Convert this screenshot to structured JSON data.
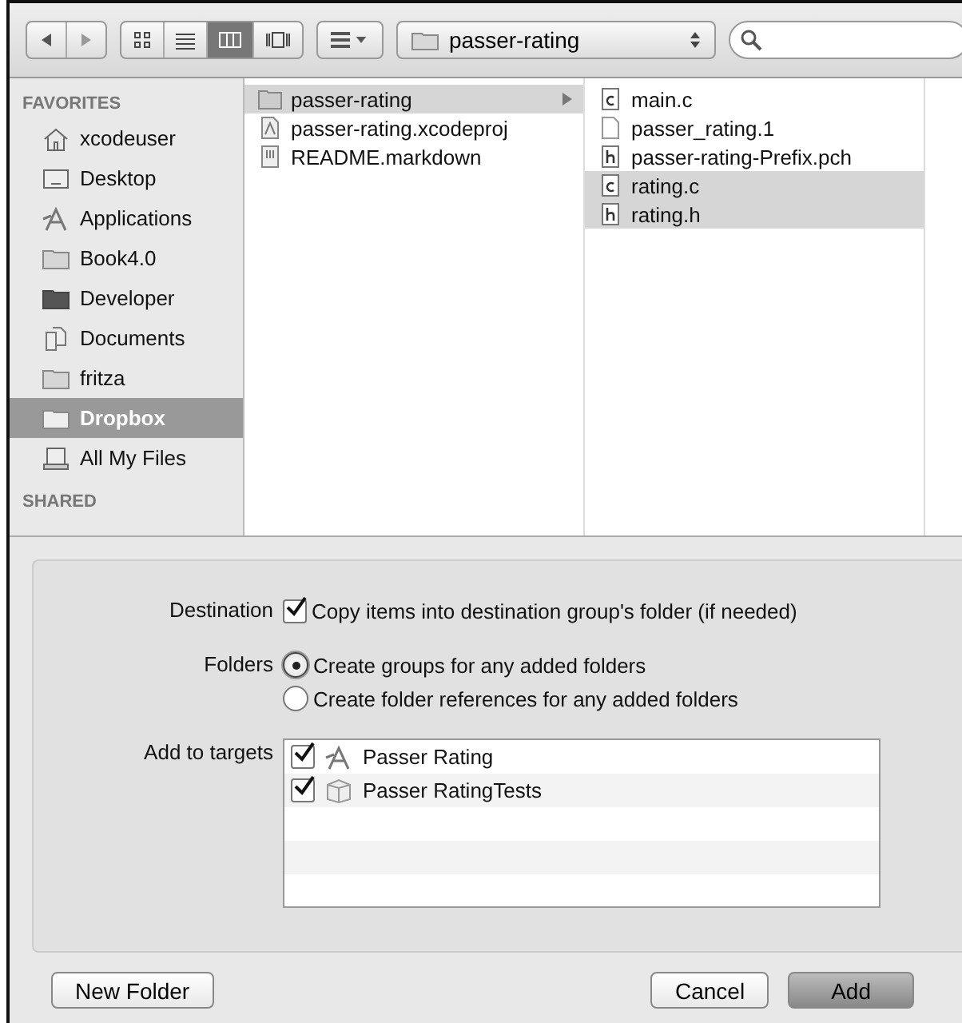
{
  "toolbar": {
    "view_modes": [
      {
        "kind": "icons",
        "selected": false
      },
      {
        "kind": "list",
        "selected": false
      },
      {
        "kind": "columns",
        "selected": true
      },
      {
        "kind": "coverflow",
        "selected": false
      }
    ],
    "path": "passer-rating"
  },
  "sidebar": {
    "favorites_heading": "FAVORITES",
    "items": [
      {
        "label": "xcodeuser",
        "kind": "home",
        "selected": false
      },
      {
        "label": "Desktop",
        "kind": "desktop",
        "selected": false
      },
      {
        "label": "Applications",
        "kind": "apps",
        "selected": false
      },
      {
        "label": "Book4.0",
        "kind": "folder",
        "selected": false
      },
      {
        "label": "Developer",
        "kind": "darkfolder",
        "selected": false
      },
      {
        "label": "Documents",
        "kind": "documents",
        "selected": false
      },
      {
        "label": "fritza",
        "kind": "folder",
        "selected": false
      },
      {
        "label": "Dropbox",
        "kind": "folder",
        "selected": true
      },
      {
        "label": "All My Files",
        "kind": "files",
        "selected": false
      }
    ],
    "shared_heading": "SHARED"
  },
  "columns": [
    {
      "items": [
        {
          "name": "passer-rating",
          "kind": "folder",
          "selected": true,
          "has_children": true
        },
        {
          "name": "passer-rating.xcodeproj",
          "kind": "project",
          "selected": false,
          "has_children": false
        },
        {
          "name": "README.markdown",
          "kind": "markdown",
          "selected": false,
          "has_children": false
        }
      ]
    },
    {
      "items": [
        {
          "name": "main.c",
          "kind": "c",
          "selected": false,
          "has_children": false
        },
        {
          "name": "passer_rating.1",
          "kind": "blank",
          "selected": false,
          "has_children": false
        },
        {
          "name": "passer-rating-Prefix.pch",
          "kind": "h",
          "selected": false,
          "has_children": false
        },
        {
          "name": "rating.c",
          "kind": "c",
          "selected": true,
          "has_children": false
        },
        {
          "name": "rating.h",
          "kind": "h",
          "selected": true,
          "has_children": false
        }
      ]
    }
  ],
  "options": {
    "destination": {
      "label": "Destination",
      "text": "Copy items into destination group's folder (if needed)",
      "checked": true
    },
    "folders": {
      "label": "Folders",
      "choices": [
        {
          "text": "Create groups for any added folders",
          "selected": true
        },
        {
          "text": "Create folder references for any added folders",
          "selected": false
        }
      ]
    },
    "targets": {
      "label": "Add to targets",
      "items": [
        {
          "name": "Passer Rating",
          "kind": "app",
          "checked": true
        },
        {
          "name": "Passer RatingTests",
          "kind": "bundle",
          "checked": true
        }
      ]
    }
  },
  "buttons": {
    "new_folder": "New Folder",
    "cancel": "Cancel",
    "add": "Add"
  }
}
